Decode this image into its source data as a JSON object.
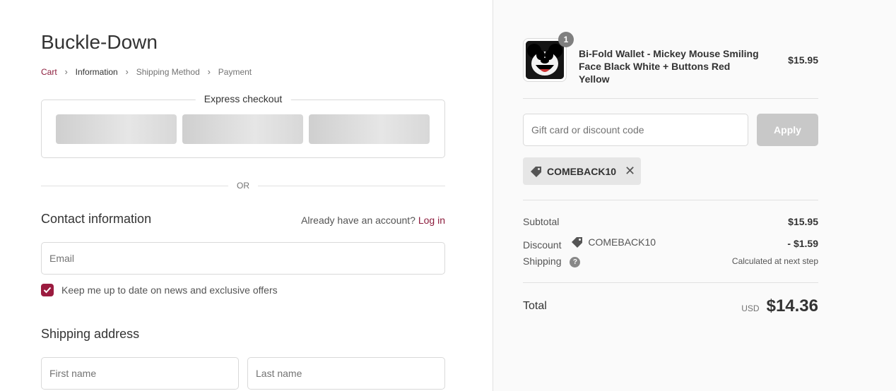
{
  "store": {
    "name": "Buckle-Down"
  },
  "breadcrumb": {
    "items": [
      {
        "label": "Cart",
        "state": "link"
      },
      {
        "label": "Information",
        "state": "current"
      },
      {
        "label": "Shipping Method",
        "state": "upcoming"
      },
      {
        "label": "Payment",
        "state": "upcoming"
      }
    ]
  },
  "express": {
    "title": "Express checkout"
  },
  "divider": {
    "label": "OR"
  },
  "contact": {
    "title": "Contact information",
    "account_prompt": "Already have an account?",
    "login_label": "Log in",
    "email_placeholder": "Email",
    "newsletter_label": "Keep me up to date on news and exclusive offers",
    "newsletter_checked": true
  },
  "shipping": {
    "title": "Shipping address",
    "first_name_placeholder": "First name",
    "last_name_placeholder": "Last name"
  },
  "order": {
    "item": {
      "quantity": "1",
      "name": "Bi-Fold Wallet - Mickey Mouse Smiling Face Black White + Buttons Red Yellow",
      "price": "$15.95"
    },
    "discount_placeholder": "Gift card or discount code",
    "apply_label": "Apply",
    "applied_code": "COMEBACK10",
    "subtotal_label": "Subtotal",
    "subtotal_value": "$15.95",
    "discount_label": "Discount",
    "discount_code": "COMEBACK10",
    "discount_value": "- $1.59",
    "shipping_label": "Shipping",
    "shipping_value": "Calculated at next step",
    "total_label": "Total",
    "currency": "USD",
    "total_value": "$14.36"
  },
  "colors": {
    "accent": "#8c1c3c",
    "checkbox": "#9b1b3f",
    "sidebar_bg": "#fafafa"
  }
}
